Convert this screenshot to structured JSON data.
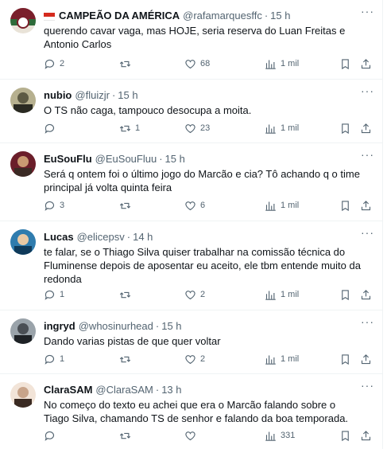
{
  "tweets": [
    {
      "name": "CAMPEÃO DA AMÉRICA",
      "has_flag": true,
      "handle": "@rafamarquesffc",
      "dot": "·",
      "time": "15 h",
      "text": "querendo cavar vaga, mas HOJE, seria reserva do Luan Freitas e Antonio Carlos",
      "replies": "2",
      "retweets": "",
      "likes": "68",
      "views": "1 mil",
      "avatar_colors": [
        "#7a1f2b",
        "#2e6b3a",
        "#e9e3d8"
      ]
    },
    {
      "name": "nubio",
      "handle": "@fluizjr",
      "dot": "·",
      "time": "15 h",
      "text": "O TS não caga, tampouco desocupa a moita.",
      "replies": "",
      "retweets": "1",
      "likes": "23",
      "views": "1 mil",
      "avatar_colors": [
        "#5d5a44",
        "#b6b08f",
        "#2a2a22"
      ]
    },
    {
      "name": "EuSouFlu",
      "handle": "@EuSouFluu",
      "dot": "·",
      "time": "15 h",
      "text": "Será q ontem foi o último jogo do Marcão e cia? Tô achando q o time principal já volta quinta feira",
      "replies": "3",
      "retweets": "",
      "likes": "6",
      "views": "1 mil",
      "avatar_colors": [
        "#3b2a24",
        "#c99a72",
        "#6b1e2a"
      ]
    },
    {
      "name": "Lucas",
      "handle": "@elicepsv",
      "dot": "·",
      "time": "14 h",
      "text": "te falar, se o Thiago Silva quiser trabalhar na comissão técnica do Fluminense depois de aposentar eu aceito, ele tbm entende muito da redonda",
      "replies": "1",
      "retweets": "",
      "likes": "2",
      "views": "1 mil",
      "avatar_colors": [
        "#0f3a5a",
        "#2f7cae",
        "#e9c9a4"
      ]
    },
    {
      "name": "ingryd",
      "handle": "@whosinurhead",
      "dot": "·",
      "time": "15 h",
      "text": "Dando varias pistas de que quer voltar",
      "replies": "1",
      "retweets": "",
      "likes": "2",
      "views": "1 mil",
      "avatar_colors": [
        "#4a4f55",
        "#9aa3aa",
        "#1e2226"
      ]
    },
    {
      "name": "ClaraSAM",
      "handle": "@ClaraSAM",
      "dot": "·",
      "time": "13 h",
      "text": "No começo do texto eu achei que era o Marcão falando sobre o Tiago Silva, chamando TS de senhor e falando da boa temporada.",
      "replies": "",
      "retweets": "",
      "likes": "",
      "views": "331",
      "avatar_colors": [
        "#3a2a22",
        "#c8a48a",
        "#f2e4d8"
      ]
    }
  ],
  "more_label": "···"
}
